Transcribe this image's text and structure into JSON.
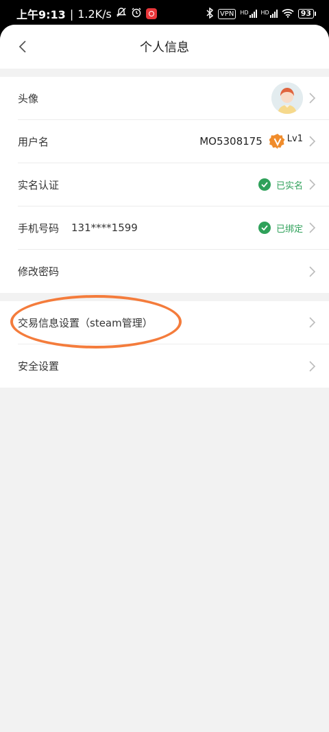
{
  "status_bar": {
    "time": "上午9:13",
    "net_speed": "1.2K/s",
    "vpn": "VPN",
    "hd1": "HD",
    "hd2": "HD",
    "battery": "93"
  },
  "header": {
    "title": "个人信息"
  },
  "profile_rows": [
    {
      "label": "头像"
    },
    {
      "label": "用户名",
      "value": "MO5308175",
      "level": "Lv1"
    },
    {
      "label": "实名认证",
      "status": "已实名"
    },
    {
      "label": "手机号码",
      "phone": "131****1599",
      "status": "已绑定"
    },
    {
      "label": "修改密码"
    }
  ],
  "settings_rows": [
    {
      "label": "交易信息设置（steam管理）"
    },
    {
      "label": "安全设置"
    }
  ],
  "colors": {
    "accent_green": "#2fa15a",
    "annotation_orange": "#f47c3c",
    "level_badge": "#f08c2b"
  }
}
